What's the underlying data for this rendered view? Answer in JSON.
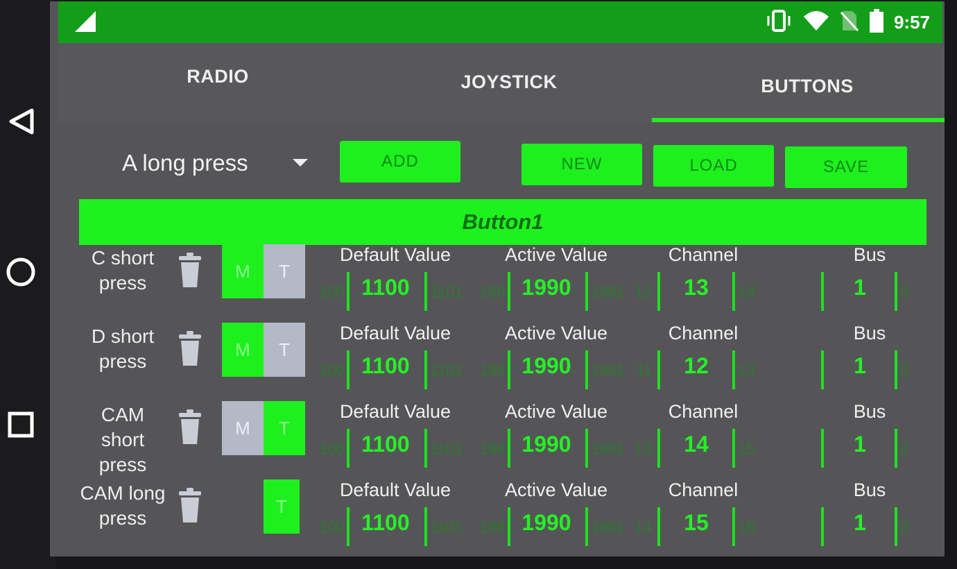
{
  "status_bar": {
    "time": "9:57",
    "icons": [
      "signal-icon",
      "vibrate-icon",
      "wifi-icon",
      "no-sim-icon",
      "battery-icon"
    ]
  },
  "tabs": [
    {
      "label": "RADIO",
      "active": false
    },
    {
      "label": "JOYSTICK",
      "active": false
    },
    {
      "label": "BUTTONS",
      "active": true
    }
  ],
  "controls": {
    "dropdown_value": "A long press",
    "add_label": "ADD",
    "new_label": "NEW",
    "load_label": "LOAD",
    "save_label": "SAVE"
  },
  "section_title": "Button1",
  "field_labels": {
    "default": "Default Value",
    "active": "Active Value",
    "channel": "Channel",
    "bus": "Bus"
  },
  "mode_labels": {
    "m": "M",
    "t": "T"
  },
  "rows": [
    {
      "label": "C short press",
      "mode": "M",
      "default": {
        "prev": "1000",
        "cur": "1100",
        "next": "1101"
      },
      "active": {
        "prev": "1989",
        "cur": "1990",
        "next": "1991"
      },
      "channel": {
        "prev": "12",
        "cur": "13",
        "next": "14"
      },
      "bus": {
        "prev": "",
        "cur": "1",
        "next": "2"
      }
    },
    {
      "label": "D short press",
      "mode": "M",
      "default": {
        "prev": "1000",
        "cur": "1100",
        "next": "1101"
      },
      "active": {
        "prev": "1989",
        "cur": "1990",
        "next": "1991"
      },
      "channel": {
        "prev": "11",
        "cur": "12",
        "next": "13"
      },
      "bus": {
        "prev": "",
        "cur": "1",
        "next": "2"
      }
    },
    {
      "label": "CAM short press",
      "mode": "T",
      "default": {
        "prev": "1000",
        "cur": "1100",
        "next": "1101"
      },
      "active": {
        "prev": "1989",
        "cur": "1990",
        "next": "1991"
      },
      "channel": {
        "prev": "13",
        "cur": "14",
        "next": "15"
      },
      "bus": {
        "prev": "",
        "cur": "1",
        "next": "2"
      }
    },
    {
      "label": "CAM long press",
      "mode": "T-only",
      "default": {
        "prev": "1000",
        "cur": "1100",
        "next": "1101"
      },
      "active": {
        "prev": "1989",
        "cur": "1990",
        "next": "1991"
      },
      "channel": {
        "prev": "14",
        "cur": "15",
        "next": "16"
      },
      "bus": {
        "prev": "",
        "cur": "1",
        "next": "2"
      }
    }
  ],
  "colors": {
    "accent_green": "#1ef01e",
    "status_bar_green": "#139e1a",
    "background": "#555558",
    "toggle_off": "#b4b9c8"
  }
}
